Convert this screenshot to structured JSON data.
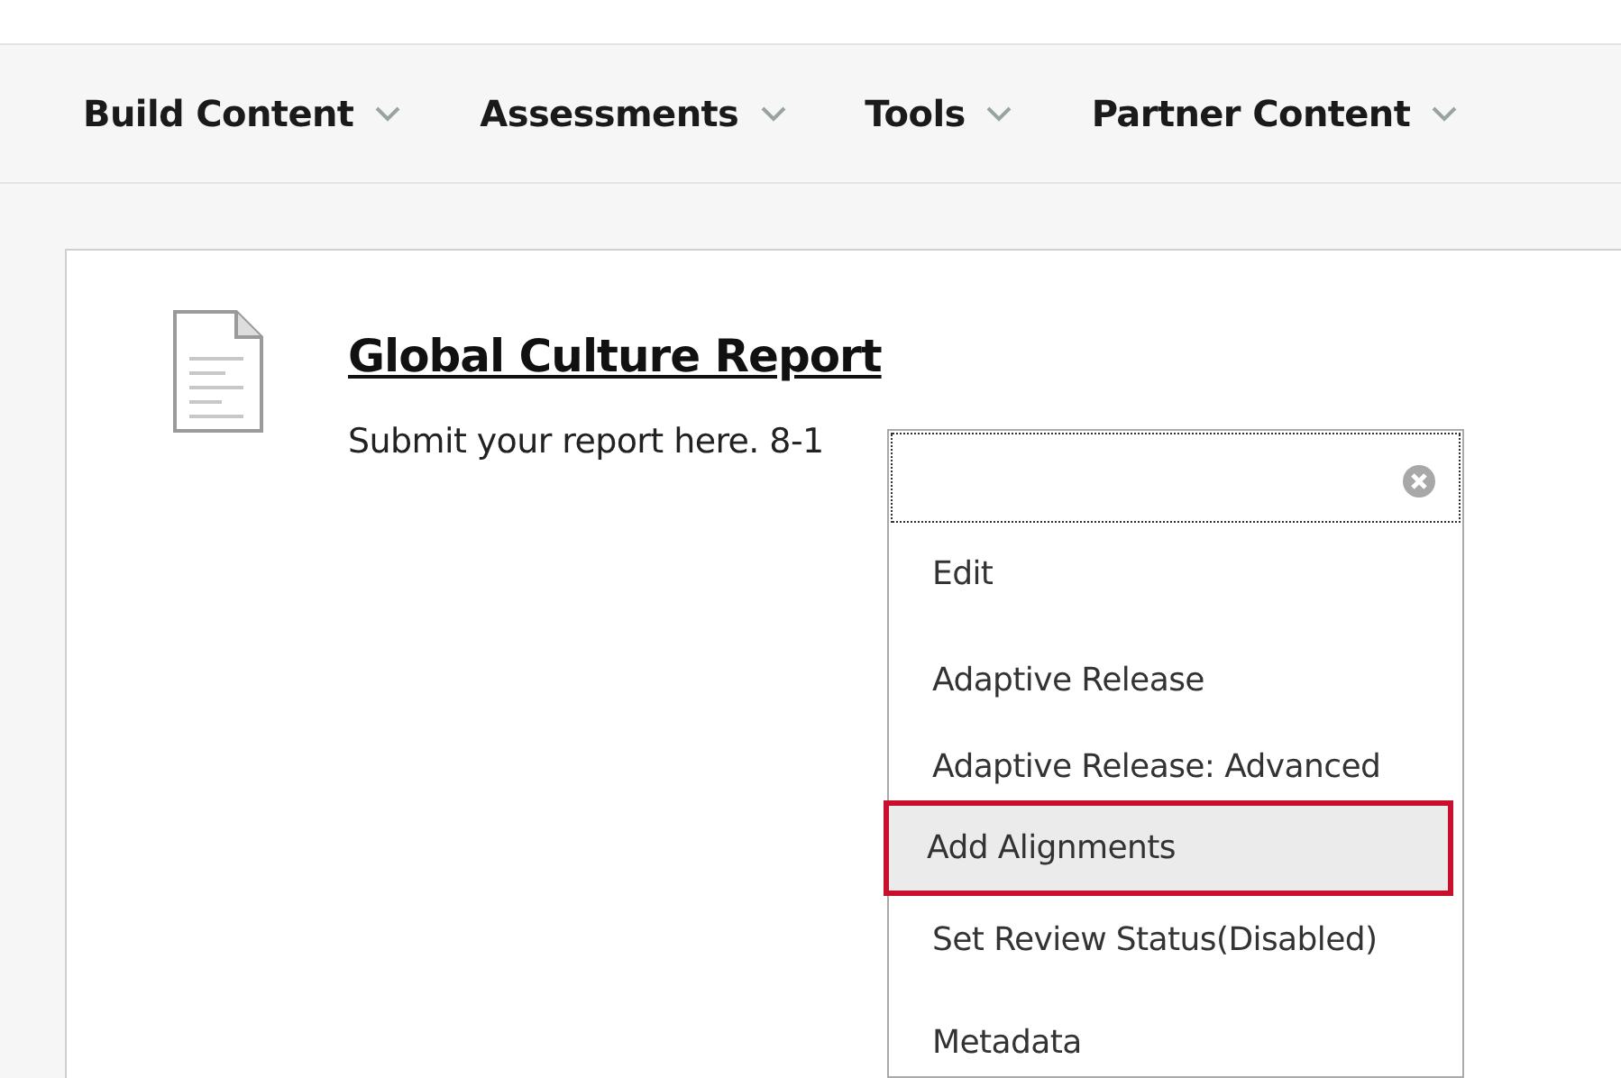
{
  "toolbar": [
    {
      "label": "Build Content"
    },
    {
      "label": "Assessments"
    },
    {
      "label": "Tools"
    },
    {
      "label": "Partner Content"
    }
  ],
  "item": {
    "title": "Global Culture Report",
    "description": "Submit your report here. 8-1"
  },
  "context_menu": {
    "items": [
      {
        "label": "Edit",
        "selected": false
      },
      {
        "label": "Adaptive Release",
        "selected": false
      },
      {
        "label": "Adaptive Release: Advanced",
        "selected": false
      },
      {
        "label": "Add Alignments",
        "selected": true
      },
      {
        "label": "Set Review Status(Disabled)",
        "selected": false
      },
      {
        "label": "Metadata",
        "selected": false
      }
    ]
  }
}
